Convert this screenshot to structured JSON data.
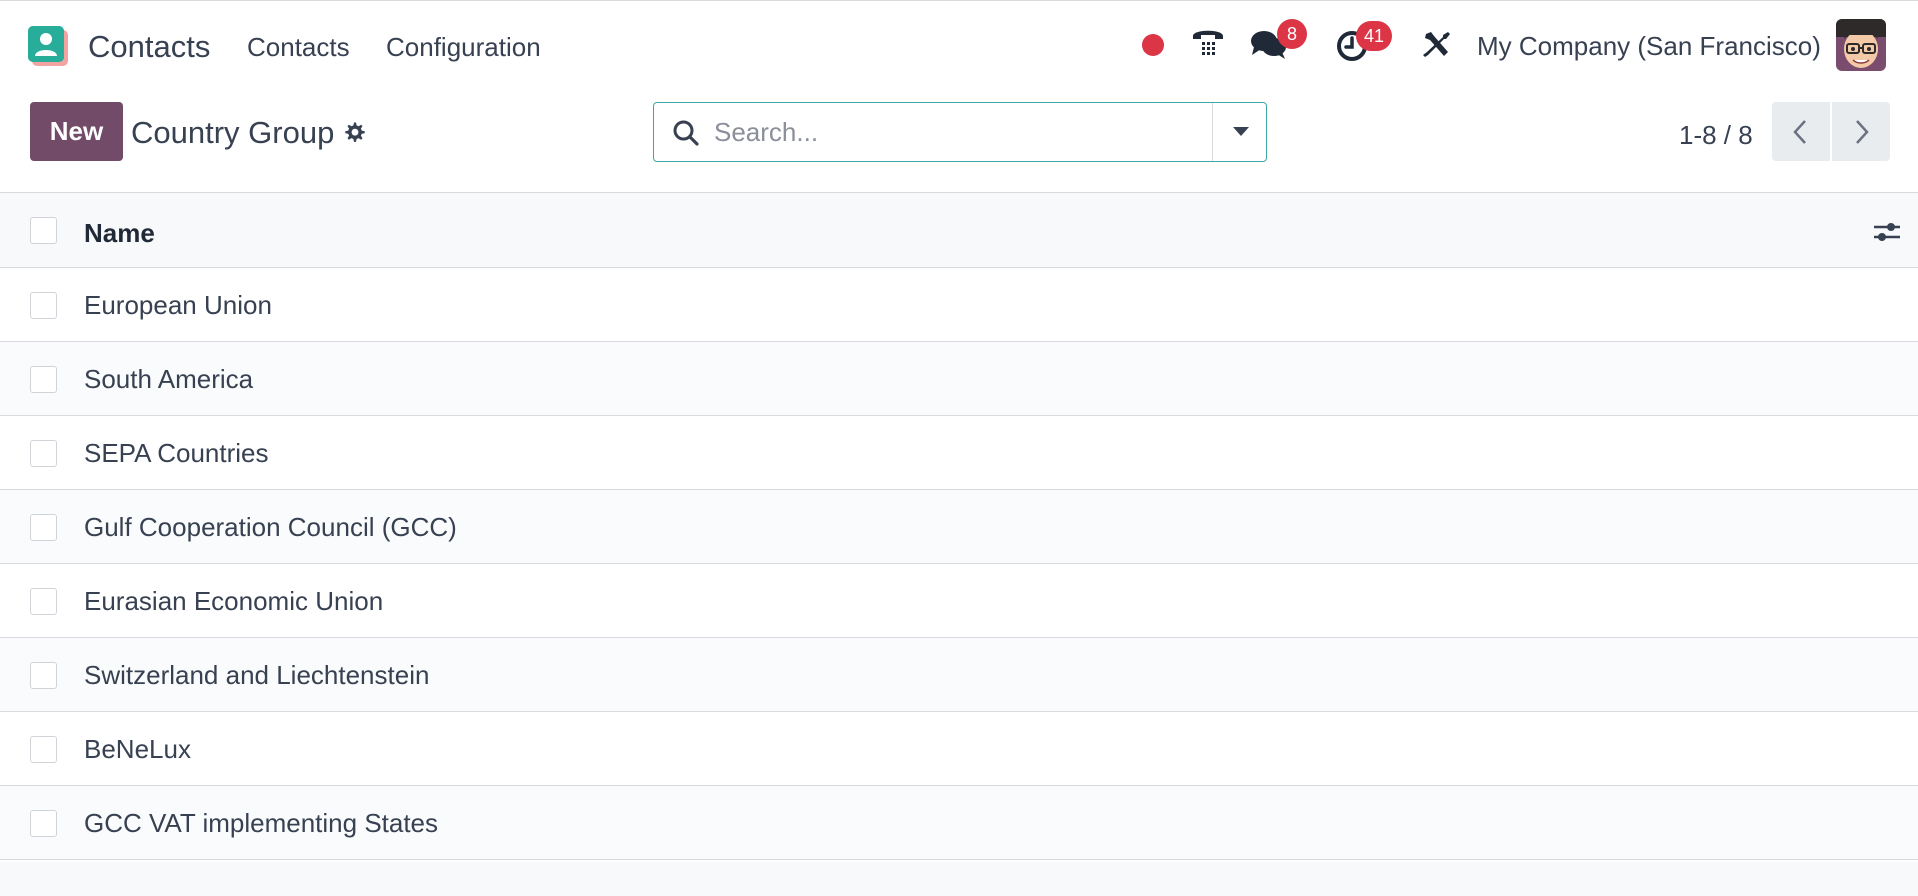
{
  "app": {
    "name": "Contacts",
    "menu": [
      {
        "label": "Contacts"
      },
      {
        "label": "Configuration"
      }
    ],
    "icons": [
      "record-dot-icon",
      "phone-icon",
      "chat-icon",
      "clock-icon",
      "tools-icon"
    ],
    "messages_badge": "8",
    "activities_badge": "41",
    "company": "My Company (San Francisco)",
    "brand_color": "#714b67",
    "badge_color": "#dc3545"
  },
  "control_panel": {
    "new_label": "New",
    "title": "Country Group",
    "search_placeholder": "Search...",
    "pager": "1-8 / 8"
  },
  "list": {
    "columns": [
      "Name"
    ],
    "rows": [
      {
        "name": "European Union"
      },
      {
        "name": "South America"
      },
      {
        "name": "SEPA Countries"
      },
      {
        "name": "Gulf Cooperation Council (GCC)"
      },
      {
        "name": "Eurasian Economic Union"
      },
      {
        "name": "Switzerland and Liechtenstein"
      },
      {
        "name": "BeNeLux"
      },
      {
        "name": "GCC VAT implementing States"
      }
    ]
  }
}
